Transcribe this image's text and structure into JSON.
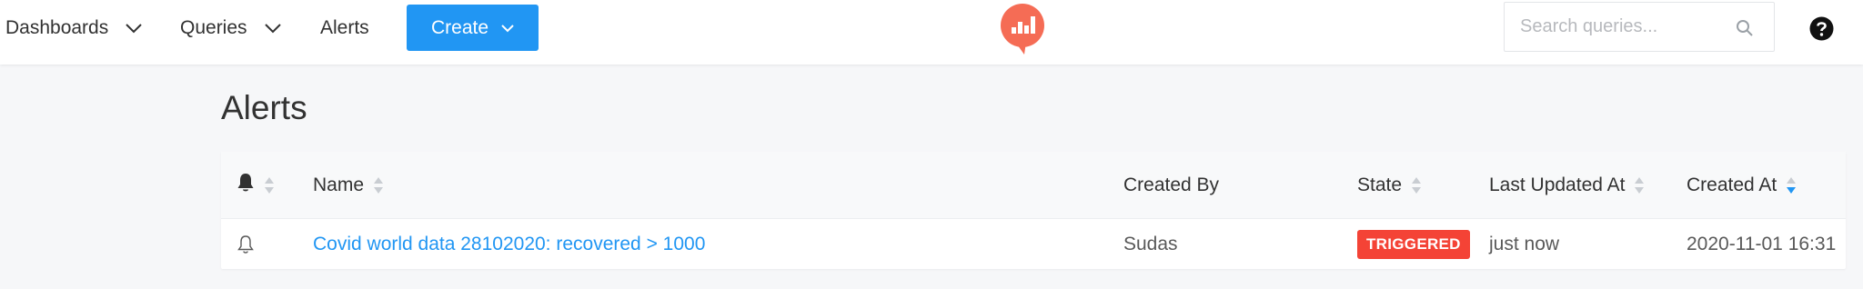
{
  "navbar": {
    "dashboards_label": "Dashboards",
    "queries_label": "Queries",
    "alerts_label": "Alerts",
    "create_label": "Create",
    "search_placeholder": "Search queries...",
    "logo_color": "#f56c55",
    "accent_color": "#2196f3"
  },
  "page": {
    "title": "Alerts"
  },
  "table": {
    "columns": {
      "name": "Name",
      "created_by": "Created By",
      "state": "State",
      "last_updated_at": "Last Updated At",
      "created_at": "Created At"
    },
    "rows": [
      {
        "name": "Covid world data 28102020: recovered > 1000",
        "created_by": "Sudas",
        "state": "TRIGGERED",
        "last_updated_at": "just now",
        "created_at": "2020-11-01 16:31"
      }
    ]
  },
  "colors": {
    "triggered": "#f44336"
  }
}
